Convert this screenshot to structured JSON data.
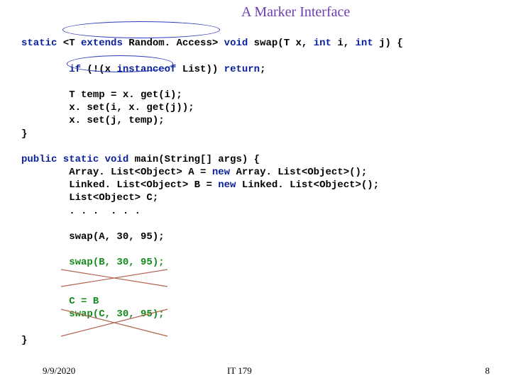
{
  "title": "A Marker Interface",
  "code": {
    "l1a": "static",
    "l1b": " <T ",
    "l1c": "extends",
    "l1d": " Random. Access> ",
    "l1e": "void",
    "l1f": " swap(T x, ",
    "l1g": "int",
    "l1h": " i, ",
    "l1i": "int",
    "l1j": " j) {",
    "l2a": "        if",
    "l2b": " (!(x ",
    "l2c": "instanceof",
    "l2d": " List)) ",
    "l2e": "return",
    "l2f": ";",
    "l3": "        T temp = x. get(i);",
    "l4": "        x. set(i, x. get(j));",
    "l5": "        x. set(j, temp);",
    "l6": "}",
    "l7a": "public static void",
    "l7b": " main(String[] args) {",
    "l8a": "        Array. List<Object> A = ",
    "l8b": "new",
    "l8c": " Array. List<Object>();",
    "l9a": "        Linked. List<Object> B = ",
    "l9b": "new",
    "l9c": " Linked. List<Object>();",
    "l10": "        List<Object> C;",
    "l11": "        . . .  . . .",
    "l12": "        swap(A, 30, 95);",
    "l13a": "        ",
    "l13b": "swap(B, 30, 95);",
    "l14a": "        ",
    "l14b": "C = B",
    "l15a": "        ",
    "l15b": "swap(C, 30, 95);",
    "l16": "}"
  },
  "footer": {
    "date": "9/9/2020",
    "center": "IT 179",
    "page": "8"
  }
}
